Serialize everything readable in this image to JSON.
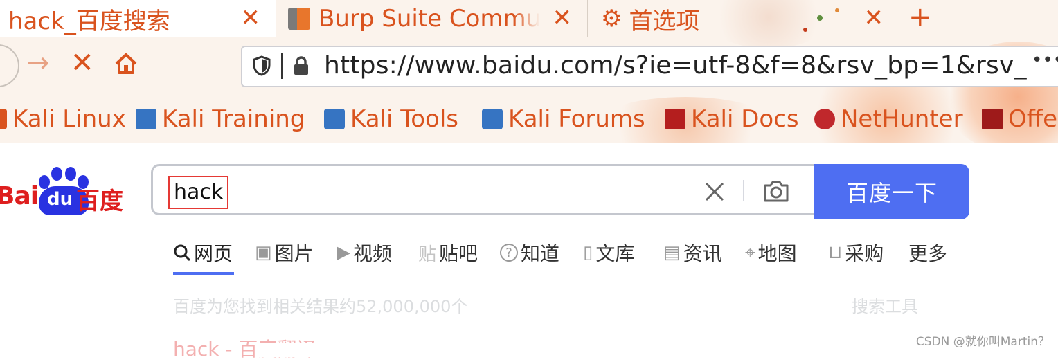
{
  "browser": {
    "tabs": [
      {
        "title": "hack_百度搜索",
        "active": true
      },
      {
        "title": "Burp Suite Commun",
        "active": false
      },
      {
        "title": "首选项",
        "active": false
      }
    ],
    "close_glyph": "✕",
    "newtab_glyph": "+",
    "nav": {
      "back_glyph": "←",
      "forward_glyph": "→",
      "stop_glyph": "✕",
      "home_glyph": "⌂"
    },
    "url": "https://www.baidu.com/s?ie=utf-8&f=8&rsv_bp=1&rsv_",
    "more_glyph": "•••",
    "bookmarks": [
      "Kali Linux",
      "Kali Training",
      "Kali Tools",
      "Kali Forums",
      "Kali Docs",
      "NetHunter",
      "Offe"
    ]
  },
  "page": {
    "logo": {
      "text_en": "Bai",
      "text_du": "du",
      "text_cn": "百度"
    },
    "search": {
      "query": "hack",
      "button": "百度一下"
    },
    "tabs": [
      {
        "label": "网页",
        "icon": "search-icon",
        "glyph": "🔍︎"
      },
      {
        "label": "图片",
        "icon": "image-icon",
        "glyph": "▣"
      },
      {
        "label": "视频",
        "icon": "video-icon",
        "glyph": "▶"
      },
      {
        "label": "贴吧",
        "icon": "tieba-icon",
        "glyph": "贴"
      },
      {
        "label": "知道",
        "icon": "question-icon",
        "glyph": "?"
      },
      {
        "label": "文库",
        "icon": "document-icon",
        "glyph": "▯"
      },
      {
        "label": "资讯",
        "icon": "news-icon",
        "glyph": "▤"
      },
      {
        "label": "地图",
        "icon": "map-icon",
        "glyph": "⌖"
      },
      {
        "label": "采购",
        "icon": "basket-icon",
        "glyph": "⊔"
      },
      {
        "label": "更多",
        "icon": "",
        "glyph": ""
      }
    ],
    "result_count": "百度为您找到相关结果约52,000,000个",
    "search_tools": "搜索工具",
    "first_result": "hack - 百度翻译"
  },
  "watermark": "CSDN @就你叫Martin？",
  "colors": {
    "accent": "#d9531e",
    "baidu_blue": "#4e6ef2",
    "baidu_red": "#de1f1f"
  }
}
